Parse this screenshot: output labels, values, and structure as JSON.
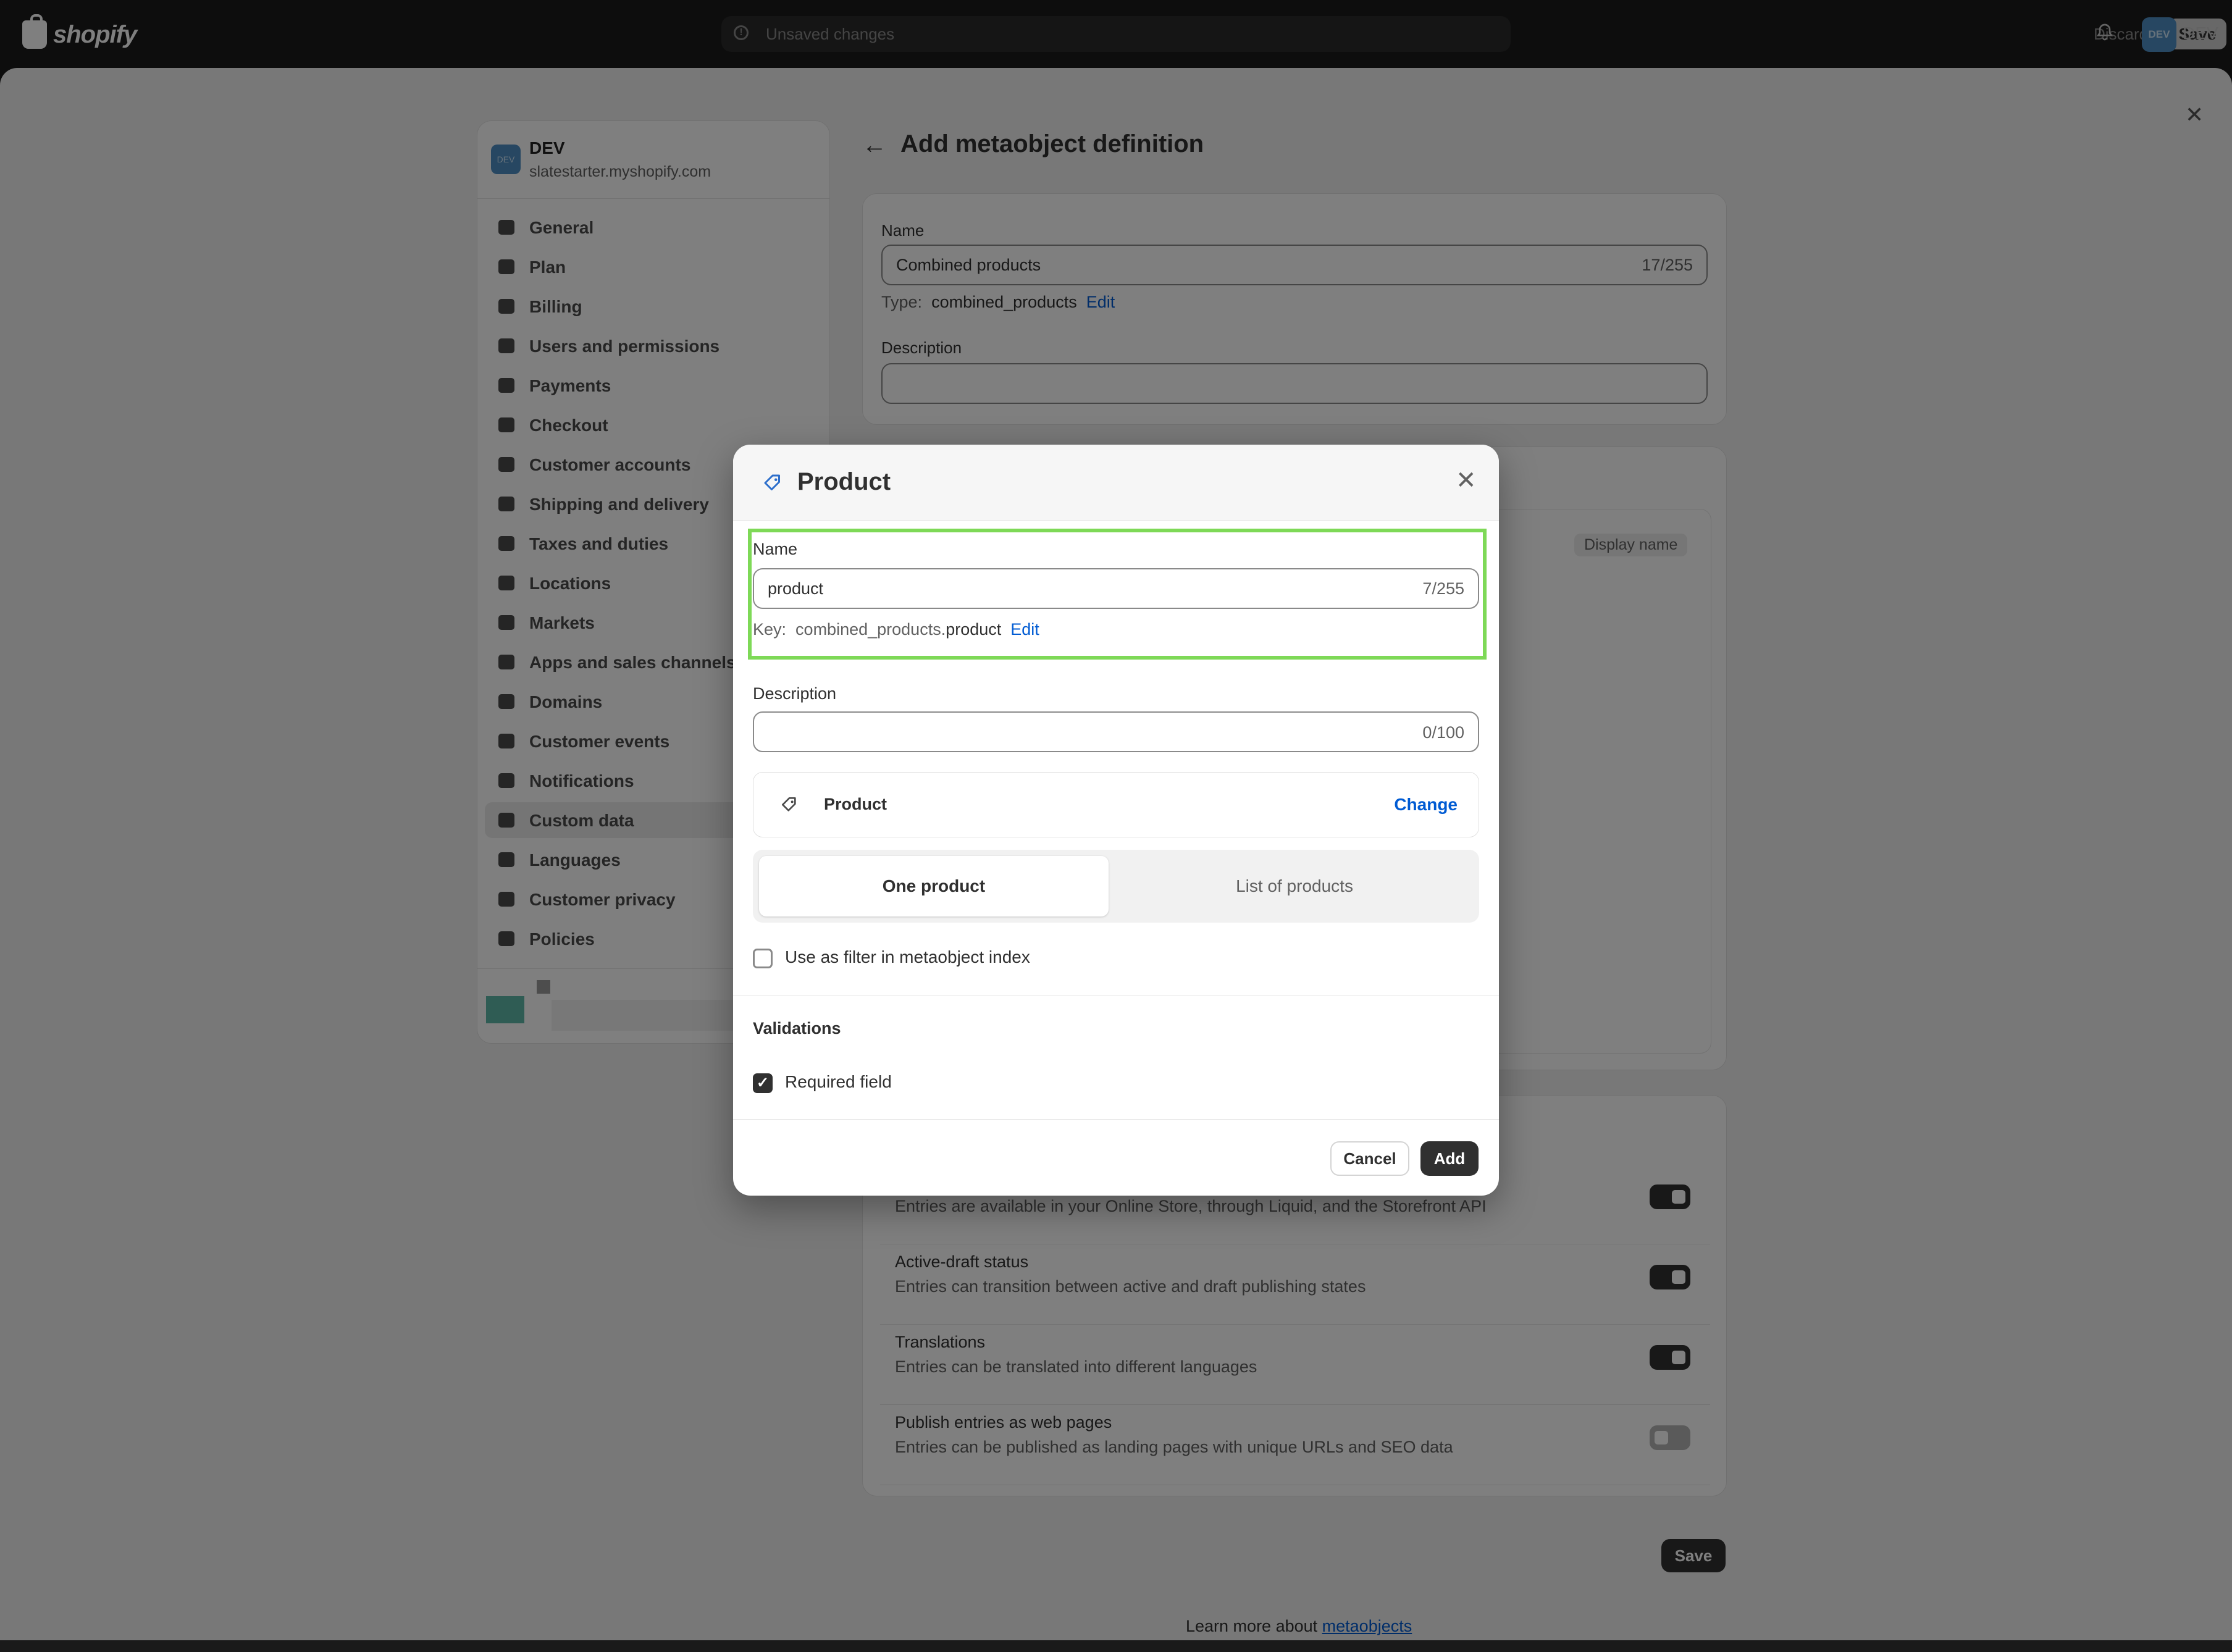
{
  "topbar": {
    "logo_text": "shopify",
    "unsaved_text": "Unsaved changes",
    "discard_label": "Discard",
    "save_label": "Save",
    "avatar_initials": "DEV",
    "user_label": "DEV"
  },
  "store": {
    "avatar_initials": "DEV",
    "name": "DEV",
    "url": "slatestarter.myshopify.com"
  },
  "sidebar": {
    "items": [
      {
        "label": "General",
        "icon": "store-icon"
      },
      {
        "label": "Plan",
        "icon": "plan-icon"
      },
      {
        "label": "Billing",
        "icon": "receipt-icon"
      },
      {
        "label": "Users and permissions",
        "icon": "users-icon"
      },
      {
        "label": "Payments",
        "icon": "payments-icon"
      },
      {
        "label": "Checkout",
        "icon": "cart-icon"
      },
      {
        "label": "Customer accounts",
        "icon": "person-icon"
      },
      {
        "label": "Shipping and delivery",
        "icon": "truck-icon"
      },
      {
        "label": "Taxes and duties",
        "icon": "tax-icon"
      },
      {
        "label": "Locations",
        "icon": "location-icon"
      },
      {
        "label": "Markets",
        "icon": "globe-icon"
      },
      {
        "label": "Apps and sales channels",
        "icon": "apps-icon"
      },
      {
        "label": "Domains",
        "icon": "domain-icon"
      },
      {
        "label": "Customer events",
        "icon": "cursor-icon"
      },
      {
        "label": "Notifications",
        "icon": "bell-icon"
      },
      {
        "label": "Custom data",
        "icon": "database-icon",
        "active": true
      },
      {
        "label": "Languages",
        "icon": "language-icon"
      },
      {
        "label": "Customer privacy",
        "icon": "lock-icon"
      },
      {
        "label": "Policies",
        "icon": "policy-icon"
      }
    ]
  },
  "main": {
    "title": "Add metaobject definition",
    "name_label": "Name",
    "name_value": "Combined products",
    "name_count": "17/255",
    "type_prefix": "Type:",
    "type_value": "combined_products",
    "type_edit": "Edit",
    "description_label": "Description",
    "display_name_badge": "Display name",
    "features": [
      {
        "title": "",
        "sub": "Entries are available in your Online Store, through Liquid, and the Storefront API",
        "on": true
      },
      {
        "title": "Active-draft status",
        "sub": "Entries can transition between active and draft publishing states",
        "on": true
      },
      {
        "title": "Translations",
        "sub": "Entries can be translated into different languages",
        "on": true
      },
      {
        "title": "Publish entries as web pages",
        "sub": "Entries can be published as landing pages with unique URLs and SEO data",
        "on": false
      }
    ],
    "save_label": "Save",
    "learn_prefix": "Learn more about",
    "learn_link": "metaobjects"
  },
  "modal": {
    "title": "Product",
    "name_label": "Name",
    "name_value": "product",
    "name_count": "7/255",
    "key_prefix": "Key:",
    "key_path": "combined_products.",
    "key_field": "product",
    "key_edit": "Edit",
    "description_label": "Description",
    "description_count": "0/100",
    "type_name": "Product",
    "type_change": "Change",
    "segment_one": "One product",
    "segment_list": "List of products",
    "filter_label": "Use as filter in metaobject index",
    "validations_title": "Validations",
    "required_label": "Required field",
    "required_checked": true,
    "cancel_label": "Cancel",
    "add_label": "Add",
    "highlight_color": "#7ed957"
  }
}
